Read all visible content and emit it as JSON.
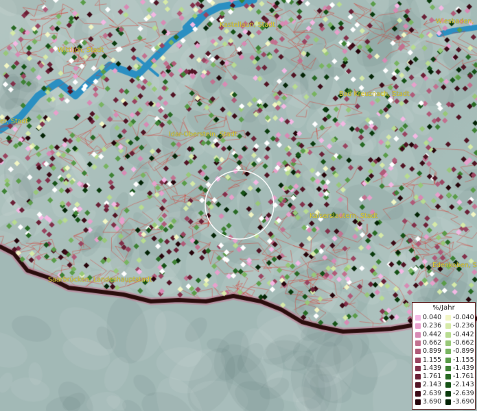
{
  "map": {
    "background_colors": {
      "land": "#a8bfbb",
      "water": "#2a8fc2",
      "border": "#2b0d0d",
      "admin_lines": "#e2564c"
    },
    "city_labels": [
      {
        "name": "Kastellaun, Stadt"
      },
      {
        "name": "Wiesbaden,"
      },
      {
        "name": "Wittlich, Stadt"
      },
      {
        "name": "Bad Kreuznach, Stadt"
      },
      {
        "name": "er, Stadt"
      },
      {
        "name": "Idar-Oberstein, Stadt"
      },
      {
        "name": "Kaiserslautern, Stadt"
      },
      {
        "name": "Edenkoben, Stad"
      },
      {
        "name": "Saarbrücken, Landeshauptstadt"
      }
    ]
  },
  "legend": {
    "title": "%/Jahr",
    "positive": [
      {
        "label": "0.040",
        "color": "#f4b8e4"
      },
      {
        "label": "0.236",
        "color": "#e8a0cc"
      },
      {
        "label": "0.442",
        "color": "#d88ab4"
      },
      {
        "label": "0.662",
        "color": "#c2708f"
      },
      {
        "label": "0.899",
        "color": "#b05a78"
      },
      {
        "label": "1.155",
        "color": "#9a4460"
      },
      {
        "label": "1.439",
        "color": "#82304a"
      },
      {
        "label": "1.761",
        "color": "#6a2036"
      },
      {
        "label": "2.143",
        "color": "#521424"
      },
      {
        "label": "2.639",
        "color": "#3c0a16"
      },
      {
        "label": "3.690",
        "color": "#26040a"
      }
    ],
    "negative": [
      {
        "label": "-0.040",
        "color": "#f2f6c4"
      },
      {
        "label": "-0.236",
        "color": "#d6eaa8"
      },
      {
        "label": "-0.442",
        "color": "#b8dc90"
      },
      {
        "label": "-0.662",
        "color": "#98c878"
      },
      {
        "label": "-0.899",
        "color": "#78b460"
      },
      {
        "label": "-1.155",
        "color": "#5a9c48"
      },
      {
        "label": "-1.439",
        "color": "#3e8234"
      },
      {
        "label": "-1.761",
        "color": "#286a24"
      },
      {
        "label": "-2.143",
        "color": "#165216"
      },
      {
        "label": "-2.639",
        "color": "#0a3a0c"
      },
      {
        "label": "-3.690",
        "color": "#042406"
      }
    ]
  }
}
